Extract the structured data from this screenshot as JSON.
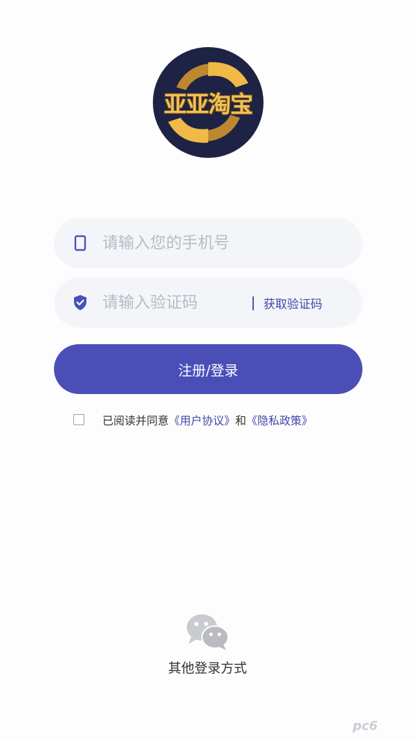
{
  "logo": {
    "text": "亚亚淘宝"
  },
  "phone_field": {
    "placeholder": "请输入您的手机号",
    "icon": "phone-icon"
  },
  "code_field": {
    "placeholder": "请输入验证码",
    "icon": "shield-check-icon",
    "get_code_label": "获取验证码"
  },
  "login_button": {
    "label": "注册/登录"
  },
  "agreement": {
    "prefix": "已阅读并同意",
    "user_agreement": "《用户协议》",
    "and": "和",
    "privacy_policy": "《隐私政策》",
    "checked": false
  },
  "other_login": {
    "icon": "wechat-icon",
    "label": "其他登录方式"
  },
  "watermark": {
    "text": "pc6"
  },
  "colors": {
    "accent": "#4a4fb8",
    "link": "#3f47a6",
    "field_bg": "#f4f5f9",
    "logo_bg": "#1e2245",
    "logo_gold": "#f1c15a"
  }
}
